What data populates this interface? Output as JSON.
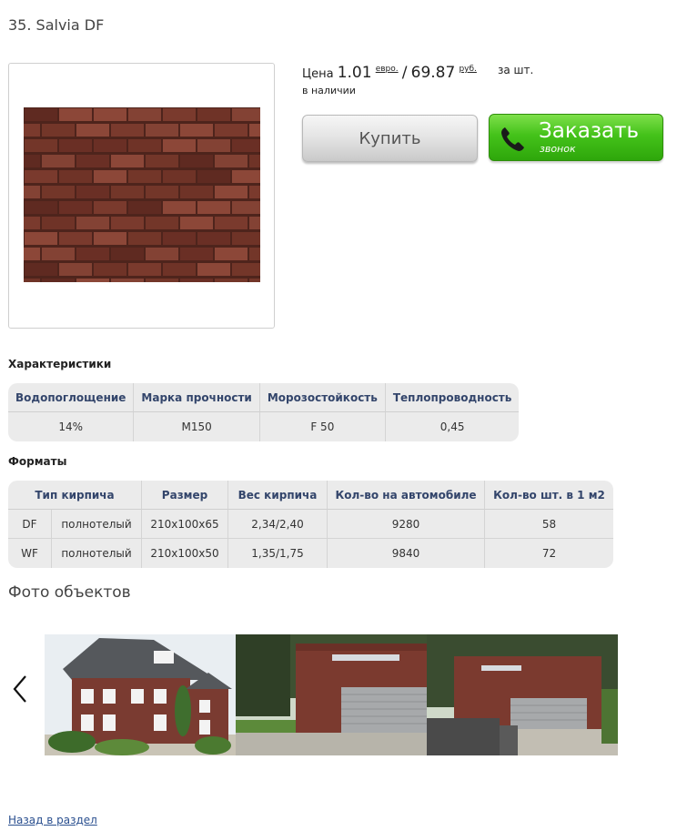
{
  "product": {
    "title": "35. Salvia DF",
    "price_label": "Цена",
    "price_eur": "1.01",
    "eur_unit": "евро.",
    "separator": "/",
    "price_rub": "69.87",
    "rub_unit": "руб.",
    "per_unit": "за шт.",
    "stock": "в наличии",
    "image_icon": "brick-texture-image"
  },
  "buttons": {
    "buy": "Купить",
    "order_main": "Заказать",
    "order_sub": "звонок",
    "order_icon": "phone-icon",
    "buy_color": "#e4e4e4",
    "order_color": "#44c21a"
  },
  "characteristics": {
    "heading": "Характеристики",
    "headers": [
      "Водопоглощение",
      "Марка прочности",
      "Морозостойкость",
      "Теплопроводность"
    ],
    "row": [
      "14%",
      "M150",
      "F 50",
      "0,45"
    ]
  },
  "formats": {
    "heading": "Форматы",
    "headers": [
      "Тип кирпича",
      "Размер",
      "Вес кирпича",
      "Кол-во на автомобиле",
      "Кол-во шт. в 1 м2"
    ],
    "rows": [
      [
        "DF",
        "полнотелый",
        "210x100x65",
        "2,34/2,40",
        "9280",
        "58"
      ],
      [
        "WF",
        "полнотелый",
        "210x100x50",
        "1,35/1,75",
        "9840",
        "72"
      ]
    ]
  },
  "gallery": {
    "heading": "Фото объектов",
    "prev_icon": "chevron-left-icon",
    "photos": [
      "house-photo",
      "garage-photo-1",
      "garage-photo-2"
    ]
  },
  "footer": {
    "back_link": "Назад в раздел"
  }
}
